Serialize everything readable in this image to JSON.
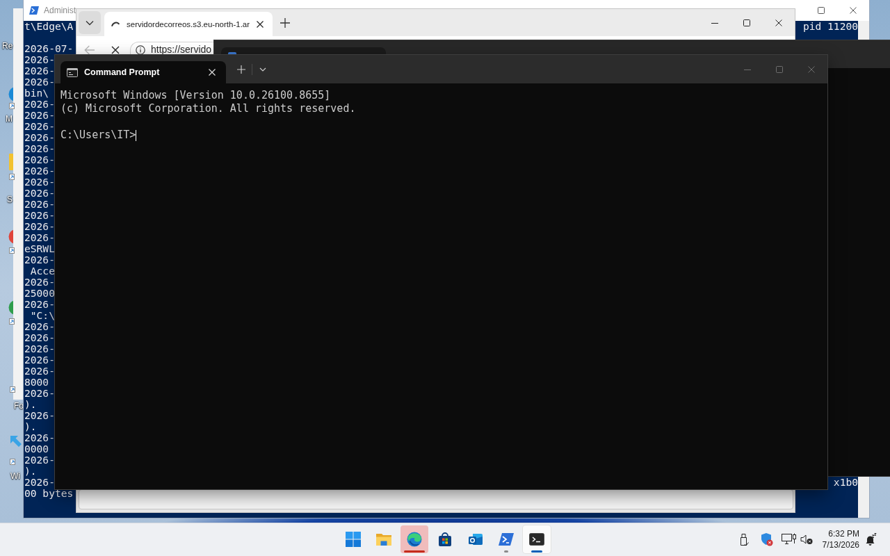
{
  "desktop": {
    "icons": [
      {
        "kind": "none",
        "label": "Re"
      },
      {
        "kind": "disc",
        "color": "#1a8ad6",
        "label": "M"
      },
      {
        "kind": "tile",
        "color": "#f2c230",
        "label": "S"
      },
      {
        "kind": "disc",
        "color": "#e0443a"
      },
      {
        "kind": "disc",
        "color": "#2f9d4c"
      },
      {
        "kind": "overlay",
        "label": "Fo"
      },
      {
        "kind": "arrow",
        "color": "#3aa4e6",
        "label": "Wi"
      }
    ]
  },
  "powershell_window": {
    "title": "Administ",
    "first_line": {
      "left": "t\\Edge\\A",
      "right": "pid 11200"
    },
    "lines": [
      {
        "text": "2026-07-"
      },
      {
        "text": "2026-"
      },
      {
        "text": "2026-"
      },
      {
        "text": "2026-"
      },
      {
        "text": "bin\\"
      },
      {
        "text": "2026-"
      },
      {
        "text": "2026-"
      },
      {
        "text": "2026-"
      },
      {
        "text": "2026-"
      },
      {
        "text": "2026-"
      },
      {
        "text": "2026-"
      },
      {
        "text": "2026-"
      },
      {
        "text": "2026-"
      },
      {
        "text": "2026-"
      },
      {
        "text": "2026-"
      },
      {
        "text": "2026-"
      },
      {
        "text": "2026-"
      },
      {
        "text": "2026-"
      },
      {
        "text": "eSRWL"
      },
      {
        "text": "2026-"
      },
      {
        "text": " Acce"
      },
      {
        "text": "2026-"
      },
      {
        "text": "25000"
      },
      {
        "text": "2026-"
      },
      {
        "text": " \"C:\\"
      },
      {
        "text": "2026-"
      },
      {
        "text": "2026-"
      },
      {
        "text": "2026-"
      },
      {
        "text": "2026-"
      },
      {
        "text": "2026-"
      },
      {
        "text": "8000"
      },
      {
        "text": "2026-"
      },
      {
        "text": ")."
      },
      {
        "text": "2026-"
      },
      {
        "text": ")."
      },
      {
        "text": "2026-"
      },
      {
        "text": "0000"
      },
      {
        "text": "2026-"
      },
      {
        "text": ")."
      },
      {
        "text": "2026-",
        "right": "x1b0"
      },
      {
        "text": "00 bytes"
      }
    ]
  },
  "browser_window": {
    "tabs": [
      {
        "title": "servidordecorreos.s3.eu-north-1.ar",
        "selected": true,
        "loading": true
      }
    ],
    "back": {
      "disabled": true
    },
    "address": "https://servido"
  },
  "terminal_window": {
    "tabs": [
      {
        "title": "Command Prompt",
        "selected": true
      }
    ],
    "output": [
      "Microsoft Windows [Version 10.0.26100.8655]",
      "(c) Microsoft Corporation. All rights reserved."
    ],
    "prompt": "C:\\Users\\IT>"
  },
  "taskbar": {
    "apps": [
      {
        "kind": "start",
        "running": false,
        "active": false,
        "attention": false
      },
      {
        "kind": "folder",
        "running": false,
        "active": false,
        "attention": false
      },
      {
        "kind": "browser",
        "running": true,
        "active": false,
        "attention": true
      },
      {
        "kind": "store",
        "running": false,
        "active": false,
        "attention": false
      },
      {
        "kind": "mail",
        "running": false,
        "active": false,
        "attention": false
      },
      {
        "kind": "shell",
        "running": true,
        "active": false,
        "attention": false
      },
      {
        "kind": "terminal",
        "running": true,
        "active": true,
        "attention": false
      }
    ],
    "tray": {
      "security_alert": true,
      "volume_muted": true,
      "time": "6:32 PM",
      "date": "7/13/2026"
    }
  }
}
